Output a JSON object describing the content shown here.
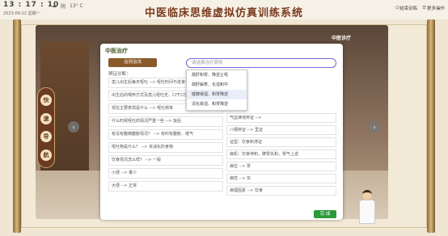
{
  "topbar": {
    "time": "13 : 17 : 10",
    "date": "2023-09-22 星期一",
    "weather": "阴",
    "temp": "13° C",
    "title": "中医临床思维虚拟仿真训练系统",
    "end": "结束训练",
    "more": "更多操作"
  },
  "scene": {
    "tag": "中医诊疗"
  },
  "nav": [
    "快",
    "速",
    "导",
    "航"
  ],
  "modal": {
    "title": "中医治疗",
    "tab": "治则治法",
    "search_placeholder": "请选择治疗原则",
    "dropdown": [
      "疏肝和胃、降逆止呕",
      "疏肝解表、化湿和中",
      "健脾燥湿、和胃降逆",
      "清化痰湿、和胃降逆"
    ],
    "history_label": "辨证诊断：",
    "left_items": [
      "患儿出生后每天呕吐 --> 呕吐时间与进食有关、进食后呕吐",
      "出生后的喂养方式及患儿呕吐史、口干口苦等",
      "现在主要表现是什么 --> 呕吐频率",
      "什么时候呕吐的情况严重一些 --> 饭后",
      "有没有腹痛腹胀情况？ --> 有时有腹胀、嗳气",
      "呕吐物是什么？ --> 未消化的食物",
      "饮食情况怎么样？ --> 一般",
      "小便 --> 量少",
      "大便 --> 正常"
    ],
    "right_items": [
      "气血津液辨证 --> ",
      "八纲辨证 --> 里证",
      "证型：饮食积滞证",
      "病机：饮食停积，脾胃失和，胃气上逆",
      "病位 --> 胃",
      "病性 --> 实",
      "病理因素 --> 饮食"
    ],
    "done": "完 成"
  }
}
